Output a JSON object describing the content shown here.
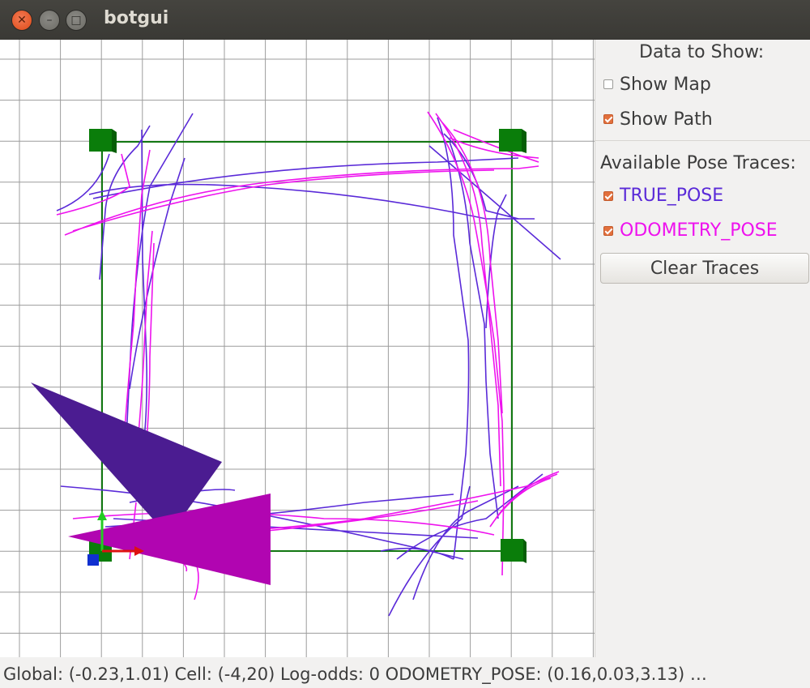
{
  "window": {
    "title": "botgui",
    "close_glyph": "✕",
    "minimize_glyph": "–",
    "maximize_glyph": "□"
  },
  "panel": {
    "data_header": "Data to Show:",
    "show_map": {
      "label": "Show Map",
      "checked": false
    },
    "show_path": {
      "label": "Show Path",
      "checked": true
    },
    "traces_header": "Available Pose Traces:",
    "traces": [
      {
        "label": "TRUE_POSE",
        "checked": true,
        "color": "#5a2ad8"
      },
      {
        "label": "ODOMETRY_POSE",
        "checked": true,
        "color": "#ee12ee"
      }
    ],
    "clear_button": "Clear Traces"
  },
  "status": {
    "text": "Global: (-0.23,1.01) Cell: (-4,20) Log-odds: 0    ODOMETRY_POSE: (0.16,0.03,3.13)  …"
  },
  "colors": {
    "true_pose": "#5a2ad8",
    "odometry_pose": "#ee12ee",
    "path": "#117711",
    "waypoint": "#0a7d0a",
    "true_robot": "#4b1c91",
    "odom_robot": "#b105b1",
    "grid": "#9c9c9c"
  }
}
